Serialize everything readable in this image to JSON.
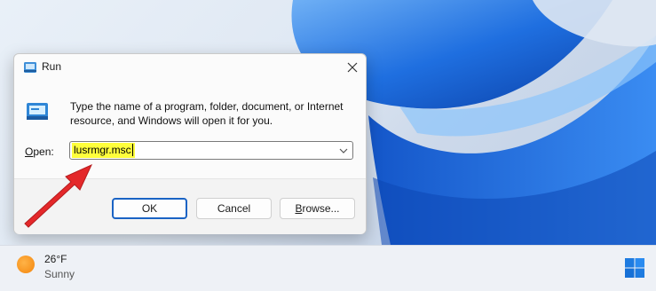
{
  "dialog": {
    "title": "Run",
    "description": "Type the name of a program, folder, document, or Internet resource, and Windows will open it for you.",
    "open_label_accel": "O",
    "open_label_rest": "pen:",
    "input_value": "lusrmgr.msc",
    "ok_label": "OK",
    "cancel_label": "Cancel",
    "browse_accel": "B",
    "browse_rest": "rowse..."
  },
  "taskbar": {
    "temperature": "26°F",
    "condition": "Sunny"
  },
  "icons": {
    "title": "run-icon",
    "close": "close-icon",
    "app": "run-app-icon",
    "dropdown": "chevron-down-icon",
    "weather": "sun-icon",
    "start": "windows-logo-icon",
    "annotation": "red-arrow-icon"
  },
  "colors": {
    "accent": "#1a63c4",
    "highlight": "#ffff3b",
    "annotation": "#e4282a"
  }
}
